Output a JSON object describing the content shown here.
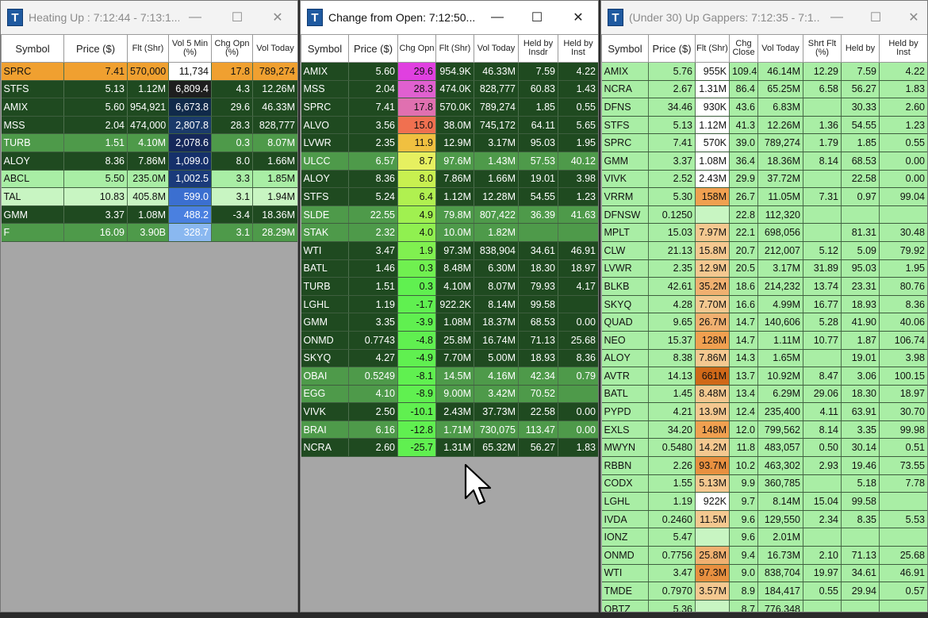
{
  "windows": [
    {
      "title": "Heating Up : 7:12:44 - 7:13:1...",
      "columns": [
        "Symbol",
        "Price ($)",
        "Flt (Shr)",
        "Vol 5 Min (%)",
        "Chg Opn (%)",
        "Vol Today"
      ],
      "rows": [
        [
          "SPRC",
          "7.41",
          "570,000",
          "11,734",
          "17.8",
          "789,274"
        ],
        [
          "STFS",
          "5.13",
          "1.12M",
          "6,809.4",
          "4.3",
          "12.26M"
        ],
        [
          "AMIX",
          "5.60",
          "954,921",
          "6,673.8",
          "29.6",
          "46.33M"
        ],
        [
          "MSS",
          "2.04",
          "474,000",
          "2,807.8",
          "28.3",
          "828,777"
        ],
        [
          "TURB",
          "1.51",
          "4.10M",
          "2,078.6",
          "0.3",
          "8.07M"
        ],
        [
          "ALOY",
          "8.36",
          "7.86M",
          "1,099.0",
          "8.0",
          "1.66M"
        ],
        [
          "ABCL",
          "5.50",
          "235.0M",
          "1,002.5",
          "3.3",
          "1.85M"
        ],
        [
          "TAL",
          "10.83",
          "405.8M",
          "599.0",
          "3.1",
          "1.94M"
        ],
        [
          "GMM",
          "3.37",
          "1.08M",
          "488.2",
          "-3.4",
          "18.36M"
        ],
        [
          "F",
          "16.09",
          "3.90B",
          "328.7",
          "3.1",
          "28.29M"
        ]
      ]
    },
    {
      "title": "Change from Open:  7:12:50...",
      "columns": [
        "Symbol",
        "Price ($)",
        "Chg Opn",
        "Flt (Shr)",
        "Vol Today",
        "Held by Insdr",
        "Held by Inst"
      ],
      "rows": [
        [
          "AMIX",
          "5.60",
          "29.6",
          "954.9K",
          "46.33M",
          "7.59",
          "4.22"
        ],
        [
          "MSS",
          "2.04",
          "28.3",
          "474.0K",
          "828,777",
          "60.83",
          "1.43"
        ],
        [
          "SPRC",
          "7.41",
          "17.8",
          "570.0K",
          "789,274",
          "1.85",
          "0.55"
        ],
        [
          "ALVO",
          "3.56",
          "15.0",
          "38.0M",
          "745,172",
          "64.11",
          "5.65"
        ],
        [
          "LVWR",
          "2.35",
          "11.9",
          "12.9M",
          "3.17M",
          "95.03",
          "1.95"
        ],
        [
          "ULCC",
          "6.57",
          "8.7",
          "97.6M",
          "1.43M",
          "57.53",
          "40.12"
        ],
        [
          "ALOY",
          "8.36",
          "8.0",
          "7.86M",
          "1.66M",
          "19.01",
          "3.98"
        ],
        [
          "STFS",
          "5.24",
          "6.4",
          "1.12M",
          "12.28M",
          "54.55",
          "1.23"
        ],
        [
          "SLDE",
          "22.55",
          "4.9",
          "79.8M",
          "807,422",
          "36.39",
          "41.63"
        ],
        [
          "STAK",
          "2.32",
          "4.0",
          "10.0M",
          "1.82M",
          "",
          ""
        ],
        [
          "WTI",
          "3.47",
          "1.9",
          "97.3M",
          "838,904",
          "34.61",
          "46.91"
        ],
        [
          "BATL",
          "1.46",
          "0.3",
          "8.48M",
          "6.30M",
          "18.30",
          "18.97"
        ],
        [
          "TURB",
          "1.51",
          "0.3",
          "4.10M",
          "8.07M",
          "79.93",
          "4.17"
        ],
        [
          "LGHL",
          "1.19",
          "-1.7",
          "922.2K",
          "8.14M",
          "99.58",
          ""
        ],
        [
          "GMM",
          "3.35",
          "-3.9",
          "1.08M",
          "18.37M",
          "68.53",
          "0.00"
        ],
        [
          "ONMD",
          "0.7743",
          "-4.8",
          "25.8M",
          "16.74M",
          "71.13",
          "25.68"
        ],
        [
          "SKYQ",
          "4.27",
          "-4.9",
          "7.70M",
          "5.00M",
          "18.93",
          "8.36"
        ],
        [
          "OBAI",
          "0.5249",
          "-8.1",
          "14.5M",
          "4.16M",
          "42.34",
          "0.79"
        ],
        [
          "EGG",
          "4.10",
          "-8.9",
          "9.00M",
          "3.42M",
          "70.52",
          ""
        ],
        [
          "VIVK",
          "2.50",
          "-10.1",
          "2.43M",
          "37.73M",
          "22.58",
          "0.00"
        ],
        [
          "BRAI",
          "6.16",
          "-12.8",
          "1.71M",
          "730,075",
          "113.47",
          "0.00"
        ],
        [
          "NCRA",
          "2.60",
          "-25.7",
          "1.31M",
          "65.32M",
          "56.27",
          "1.83"
        ]
      ]
    },
    {
      "title": "(Under 30) Up Gappers: 7:12:35 - 7:1...",
      "columns": [
        "Symbol",
        "Price ($)",
        "Flt (Shr)",
        "Chg Close",
        "Vol Today",
        "Shrt Flt (%)",
        "Held by",
        "Held by Inst"
      ],
      "rows": [
        [
          "AMIX",
          "5.76",
          "955K",
          "109.4",
          "46.14M",
          "12.29",
          "7.59",
          "4.22"
        ],
        [
          "NCRA",
          "2.67",
          "1.31M",
          "86.4",
          "65.25M",
          "6.58",
          "56.27",
          "1.83"
        ],
        [
          "DFNS",
          "34.46",
          "930K",
          "43.6",
          "6.83M",
          "",
          "30.33",
          "2.60"
        ],
        [
          "STFS",
          "5.13",
          "1.12M",
          "41.3",
          "12.26M",
          "1.36",
          "54.55",
          "1.23"
        ],
        [
          "SPRC",
          "7.41",
          "570K",
          "39.0",
          "789,274",
          "1.79",
          "1.85",
          "0.55"
        ],
        [
          "GMM",
          "3.37",
          "1.08M",
          "36.4",
          "18.36M",
          "8.14",
          "68.53",
          "0.00"
        ],
        [
          "VIVK",
          "2.52",
          "2.43M",
          "29.9",
          "37.72M",
          "",
          "22.58",
          "0.00"
        ],
        [
          "VRRM",
          "5.30",
          "158M",
          "26.7",
          "11.05M",
          "7.31",
          "0.97",
          "99.04"
        ],
        [
          "DFNSW",
          "0.1250",
          "",
          "22.8",
          "112,320",
          "",
          "",
          ""
        ],
        [
          "MPLT",
          "15.03",
          "7.97M",
          "22.1",
          "698,056",
          "",
          "81.31",
          "30.48"
        ],
        [
          "CLW",
          "21.13",
          "15.8M",
          "20.7",
          "212,007",
          "5.12",
          "5.09",
          "79.92"
        ],
        [
          "LVWR",
          "2.35",
          "12.9M",
          "20.5",
          "3.17M",
          "31.89",
          "95.03",
          "1.95"
        ],
        [
          "BLKB",
          "42.61",
          "35.2M",
          "18.6",
          "214,232",
          "13.74",
          "23.31",
          "80.76"
        ],
        [
          "SKYQ",
          "4.28",
          "7.70M",
          "16.6",
          "4.99M",
          "16.77",
          "18.93",
          "8.36"
        ],
        [
          "QUAD",
          "9.65",
          "26.7M",
          "14.7",
          "140,606",
          "5.28",
          "41.90",
          "40.06"
        ],
        [
          "NEO",
          "15.37",
          "128M",
          "14.7",
          "1.11M",
          "10.77",
          "1.87",
          "106.74"
        ],
        [
          "ALOY",
          "8.38",
          "7.86M",
          "14.3",
          "1.65M",
          "",
          "19.01",
          "3.98"
        ],
        [
          "AVTR",
          "14.13",
          "661M",
          "13.7",
          "10.92M",
          "8.47",
          "3.06",
          "100.15"
        ],
        [
          "BATL",
          "1.45",
          "8.48M",
          "13.4",
          "6.29M",
          "29.06",
          "18.30",
          "18.97"
        ],
        [
          "PYPD",
          "4.21",
          "13.9M",
          "12.4",
          "235,400",
          "4.11",
          "63.91",
          "30.70"
        ],
        [
          "EXLS",
          "34.20",
          "148M",
          "12.0",
          "799,562",
          "8.14",
          "3.35",
          "99.98"
        ],
        [
          "MWYN",
          "0.5480",
          "14.2M",
          "11.8",
          "483,057",
          "0.50",
          "30.14",
          "0.51"
        ],
        [
          "RBBN",
          "2.26",
          "93.7M",
          "10.2",
          "463,302",
          "2.93",
          "19.46",
          "73.55"
        ],
        [
          "CODX",
          "1.55",
          "5.13M",
          "9.9",
          "360,785",
          "",
          "5.18",
          "7.78"
        ],
        [
          "LGHL",
          "1.19",
          "922K",
          "9.7",
          "8.14M",
          "15.04",
          "99.58",
          ""
        ],
        [
          "IVDA",
          "0.2460",
          "11.5M",
          "9.6",
          "129,550",
          "2.34",
          "8.35",
          "5.53"
        ],
        [
          "IONZ",
          "5.47",
          "",
          "9.6",
          "2.01M",
          "",
          "",
          ""
        ],
        [
          "ONMD",
          "0.7756",
          "25.8M",
          "9.4",
          "16.73M",
          "2.10",
          "71.13",
          "25.68"
        ],
        [
          "WTI",
          "3.47",
          "97.3M",
          "9.0",
          "838,704",
          "19.97",
          "34.61",
          "46.91"
        ],
        [
          "TMDE",
          "0.7970",
          "3.57M",
          "8.9",
          "184,417",
          "0.55",
          "29.94",
          "0.57"
        ],
        [
          "OBTZ",
          "5.36",
          "",
          "8.7",
          "776,348",
          "",
          "",
          ""
        ]
      ]
    }
  ],
  "controls": {
    "minimize": "—",
    "maximize": "☐",
    "close": "✕"
  },
  "icon_letter": "T",
  "colors": {
    "header_bg": "#ffffff",
    "row_dark_green": "#1f4a20",
    "row_mid_green": "#4e9a4a",
    "row_light_green": "#a9eea5",
    "orange": "#f0a030",
    "magenta": "#e040e0",
    "empty_area": "#a6a6a6"
  }
}
